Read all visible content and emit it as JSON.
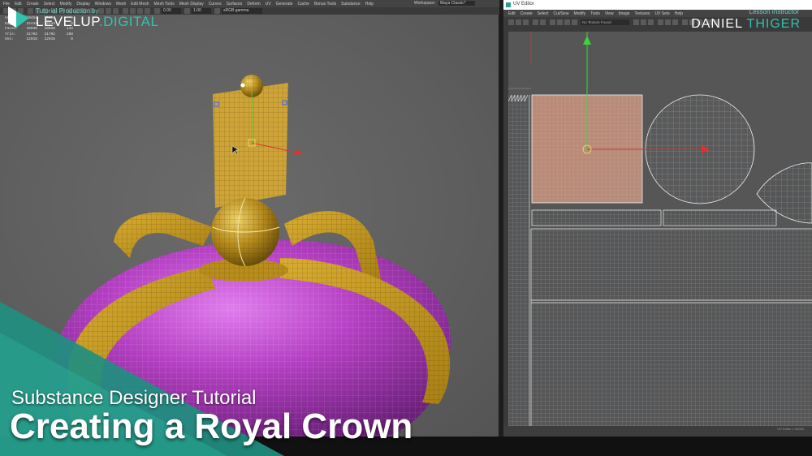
{
  "maya": {
    "menu": [
      "File",
      "Edit",
      "Create",
      "Select",
      "Modify",
      "Display",
      "Windows",
      "Mesh",
      "Edit Mesh",
      "Mesh Tools",
      "Mesh Display",
      "Curves",
      "Surfaces",
      "Deform",
      "UV",
      "Generate",
      "Cache",
      "Bonus Tools",
      "Substance",
      "Help"
    ],
    "workspace_label": "Workspace:",
    "workspace_value": "Maya Classic*",
    "toolbar": {
      "value_a": "0.00",
      "value_b": "1.00",
      "colorspace": "sRGB gamma"
    },
    "hud": {
      "rows": [
        {
          "label": "Verts:",
          "a": "10454",
          "b": "10454",
          "c": "0"
        },
        {
          "label": "Edges:",
          "a": "22444",
          "b": "22444",
          "c": "0"
        },
        {
          "label": "Faces:",
          "a": "10030",
          "b": "10030",
          "c": "144"
        },
        {
          "label": "Tris:",
          "a": "21702",
          "b": "21702",
          "c": "288"
        },
        {
          "label": "UVs:",
          "a": "12015",
          "b": "12015",
          "c": "0"
        }
      ]
    }
  },
  "uv_editor": {
    "title": "UV Editor",
    "menu": [
      "Edit",
      "Create",
      "Select",
      "Cut/Sew",
      "Modify",
      "Tools",
      "View",
      "Image",
      "Textures",
      "UV Sets",
      "Help"
    ],
    "uvset": "No Texture Found",
    "status": "UV Editor 1.00000"
  },
  "branding": {
    "tutorial_production_by": "Tutorial Production by",
    "logo_part1": "LEVELUP",
    "logo_part2": ".DIGITAL",
    "lesson_instructor": "Lesson Instructor",
    "instructor_first": "DANIEL",
    "instructor_last": "THIGER"
  },
  "overlay": {
    "subtitle": "Substance Designer Tutorial",
    "title": "Creating a Royal Crown"
  },
  "colors": {
    "accent": "#31c3b0",
    "crown_gold": "#c9a227",
    "crown_purple": "#b83fc4",
    "uv_highlight": "#c79a84"
  }
}
